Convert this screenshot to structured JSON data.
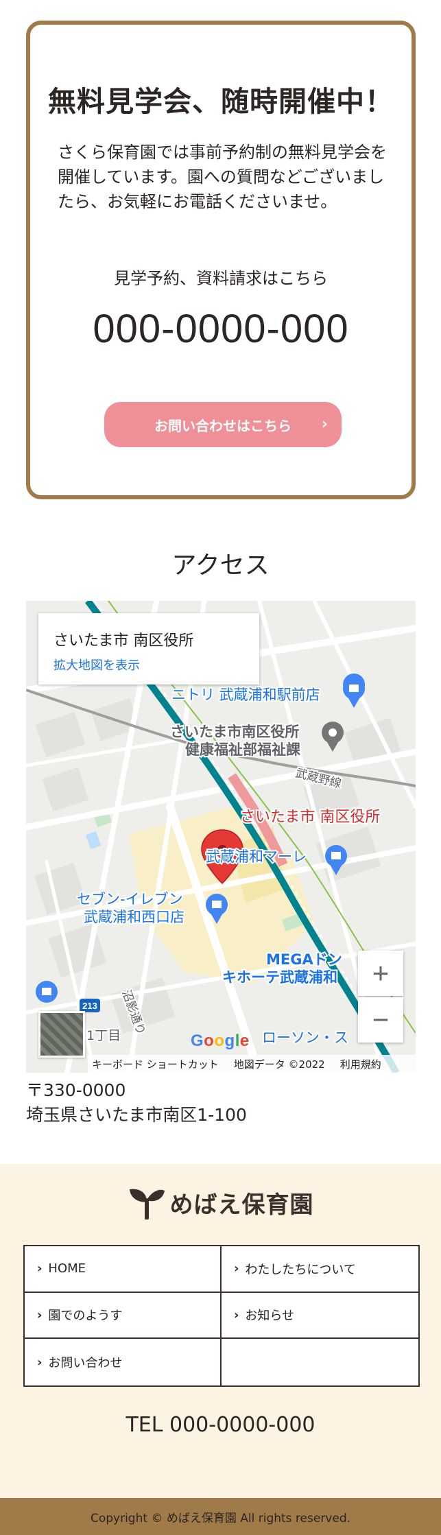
{
  "info_card": {
    "title": "無料見学会、随時開催中！",
    "description": "さくら保育園では事前予約制の無料見学会を開催しています。園への質問などございましたら、お気軽にお電話くださいませ。",
    "sub_heading": "見学予約、資料請求はこちら",
    "phone": "000-0000-000",
    "button_label": "お問い合わせはこちら",
    "button_icon": "chevron-right-icon"
  },
  "access": {
    "heading": "アクセス",
    "map": {
      "place_name": "さいたま市 南区役所",
      "view_larger_link": "拡大地図を表示",
      "marker_label": "さいたま市 南区役所",
      "labels": {
        "nitori": "ニトリ 武蔵浦和駅前店",
        "ward_office_1": "さいたま市南区役所",
        "ward_office_2": "健康福祉部福祉課",
        "musashino_line": "武蔵野線",
        "marble": "武蔵浦和マーレ",
        "seven_1": "セブン-イレブン",
        "seven_2": "武蔵浦和西口店",
        "mega_1": "MEGAドン",
        "mega_2": "キホーテ武蔵浦和",
        "numakage": "沼影通り",
        "route": "213",
        "chome": "1丁目",
        "lawson": "ローソン・ス"
      },
      "google_logo": "Google",
      "footer": {
        "keyboard": "キーボード ショートカット",
        "map_data": "地図データ ©2022",
        "terms": "利用規約"
      },
      "zoom_in": "+",
      "zoom_out": "−",
      "colors": {
        "marker": "#e53935",
        "poi_blue": "#1a73e8",
        "rail_pink": "#ef9a9a",
        "rail_teal": "#00838f"
      }
    },
    "address": {
      "postal": "〒330-0000",
      "line": "埼玉県さいたま市南区1-100"
    }
  },
  "footer": {
    "logo_text": "めばえ保育園",
    "logo_icon": "sprout-icon",
    "nav": [
      {
        "label": "HOME"
      },
      {
        "label": "わたしたちについて"
      },
      {
        "label": "園でのようす"
      },
      {
        "label": "お知らせ"
      },
      {
        "label": "お問い合わせ"
      },
      {
        "label": ""
      }
    ],
    "tel": "TEL 000-0000-000",
    "copyright": "Copyright © めばえ保育園 All rights reserved."
  },
  "colors": {
    "accent_brown": "#a07a48",
    "button_pink": "#ef8f98",
    "footer_bg": "#fcf3e3",
    "text": "#2b2523"
  }
}
